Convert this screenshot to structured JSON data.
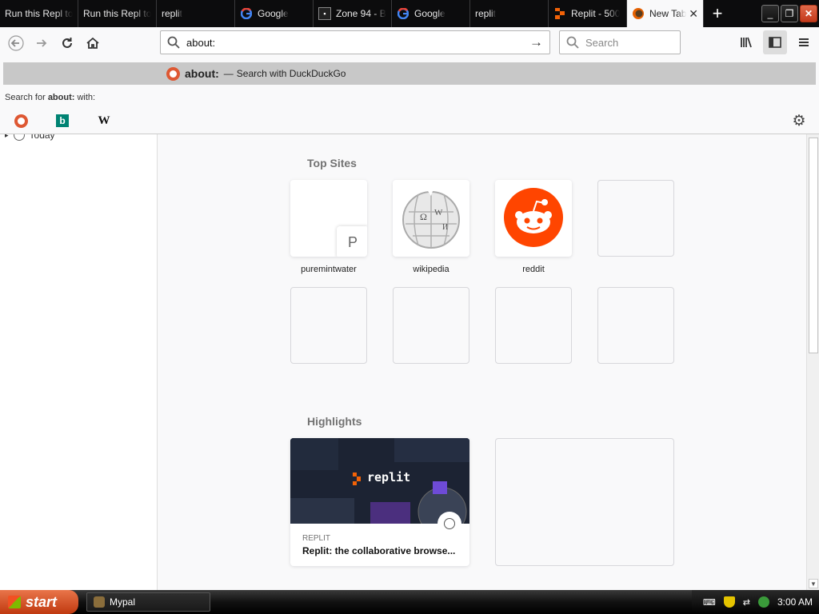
{
  "tabs": [
    {
      "title": "Run this Repl to",
      "icon": "none"
    },
    {
      "title": "Run this Repl to",
      "icon": "none"
    },
    {
      "title": "replit",
      "icon": "none"
    },
    {
      "title": "Google",
      "icon": "google-icon"
    },
    {
      "title": "Zone 94 - B",
      "icon": "zone94-icon"
    },
    {
      "title": "Google",
      "icon": "google-icon"
    },
    {
      "title": "replit",
      "icon": "none"
    },
    {
      "title": "Replit - 500",
      "icon": "replit-icon"
    },
    {
      "title": "New Tab",
      "icon": "firefox-icon",
      "active": true
    }
  ],
  "urlbar": {
    "value": "about:"
  },
  "searchbar": {
    "placeholder": "Search"
  },
  "popup": {
    "suggestion": {
      "query": "about:",
      "dash": "—",
      "action": "Search with DuckDuckGo"
    },
    "search_for": {
      "prefix": "Search for",
      "query": "about:",
      "suffix": "with:"
    },
    "engines": [
      "DuckDuckGo",
      "Bing",
      "Wikipedia"
    ]
  },
  "sidebar": {
    "group": "Today"
  },
  "top_sites": {
    "title": "Top Sites",
    "sites": [
      {
        "label": "puremintwater",
        "letter": "P"
      },
      {
        "label": "wikipedia",
        "letter": ""
      },
      {
        "label": "reddit",
        "letter": ""
      }
    ]
  },
  "highlights": {
    "title": "Highlights",
    "card": {
      "host": "REPLIT",
      "title": "Replit: the collaborative browse...",
      "thumb_text": "replit"
    }
  },
  "taskbar": {
    "start": "start",
    "task": "Mypal",
    "clock": "3:00 AM"
  },
  "colors": {
    "accent_reddit": "#ff4500",
    "ddg": "#de5833",
    "bing": "#008373",
    "tabstrip": "#0c0c0d"
  }
}
